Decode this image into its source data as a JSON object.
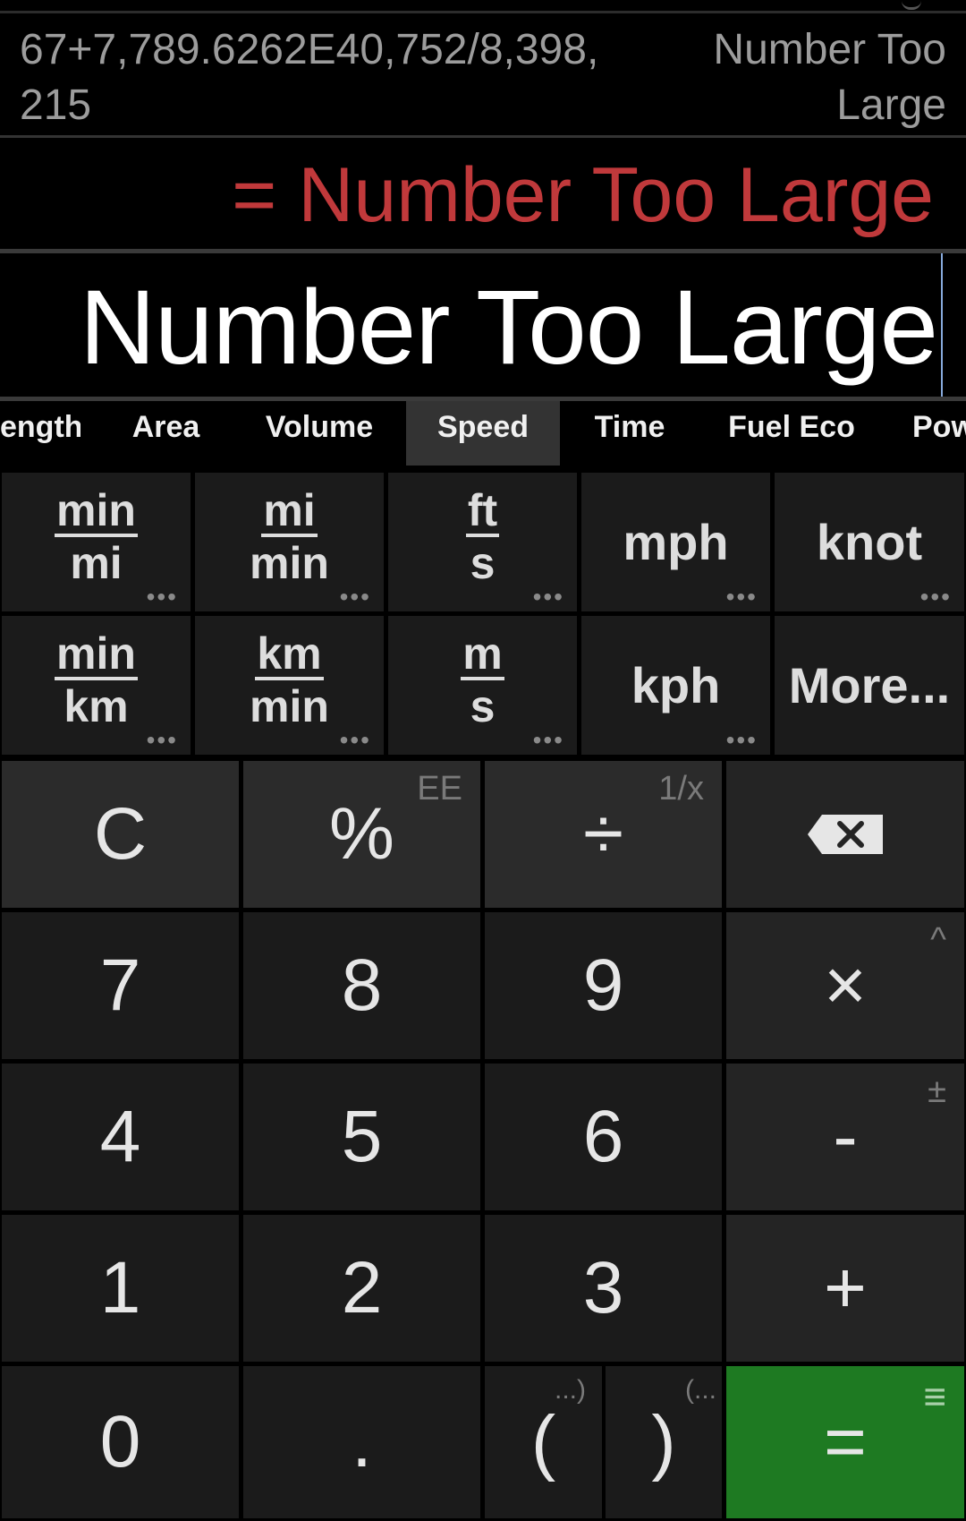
{
  "history": {
    "expression": "67+7,789.6262E40,752/8,398,215",
    "result": "Number Too Large"
  },
  "result": "= Number Too Large",
  "entry": "Number Too Large",
  "tabs": [
    "ength",
    "Area",
    "Volume",
    "Speed",
    "Time",
    "Fuel Eco",
    "Pow"
  ],
  "active_tab": "Speed",
  "units": {
    "min_mi": {
      "num": "min",
      "den": "mi"
    },
    "mi_min": {
      "num": "mi",
      "den": "min"
    },
    "ft_s": {
      "num": "ft",
      "den": "s"
    },
    "mph": "mph",
    "knot": "knot",
    "min_km": {
      "num": "min",
      "den": "km"
    },
    "km_min": {
      "num": "km",
      "den": "min"
    },
    "m_s": {
      "num": "m",
      "den": "s"
    },
    "kph": "kph",
    "more": "More...",
    "dots": "•••"
  },
  "keys": {
    "clear": "C",
    "percent": "%",
    "percent_sub": "EE",
    "divide": "÷",
    "divide_sub": "1/x",
    "seven": "7",
    "eight": "8",
    "nine": "9",
    "multiply": "×",
    "multiply_sub": "^",
    "four": "4",
    "five": "5",
    "six": "6",
    "minus": "-",
    "minus_sub": "±",
    "one": "1",
    "two": "2",
    "three": "3",
    "plus": "+",
    "zero": "0",
    "dot": ".",
    "lparen": "(",
    "lparen_sub": "...)",
    "rparen": ")",
    "rparen_sub": "(...",
    "equals": "=",
    "equals_sub": "≡"
  },
  "colors": {
    "accent_green": "#1e7a22",
    "result_red": "#c0393b"
  }
}
